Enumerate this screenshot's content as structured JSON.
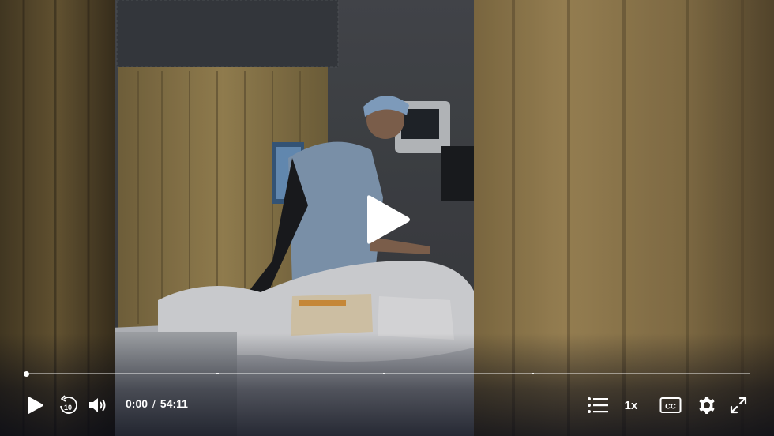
{
  "video": {
    "subject": "Surgeon in scrubs writing notes beside a hospital bed, viewed between curtains"
  },
  "controls": {
    "current_time": "0:00",
    "separator": "/",
    "duration": "54:11",
    "playback_speed": "1x",
    "captions_label": "CC",
    "progress_fraction": 0.0
  },
  "icons": {
    "big_play": "play-icon",
    "play": "play-icon",
    "rewind": "rewind-10-icon",
    "rewind_text": "10",
    "volume": "volume-icon",
    "chapters": "list-icon",
    "captions": "cc-icon",
    "settings": "gear-icon",
    "fullscreen": "fullscreen-icon"
  },
  "colors": {
    "controls_text": "#ffffff",
    "curtain": "#b9a06a",
    "scrubs": "#8fa8c4"
  }
}
